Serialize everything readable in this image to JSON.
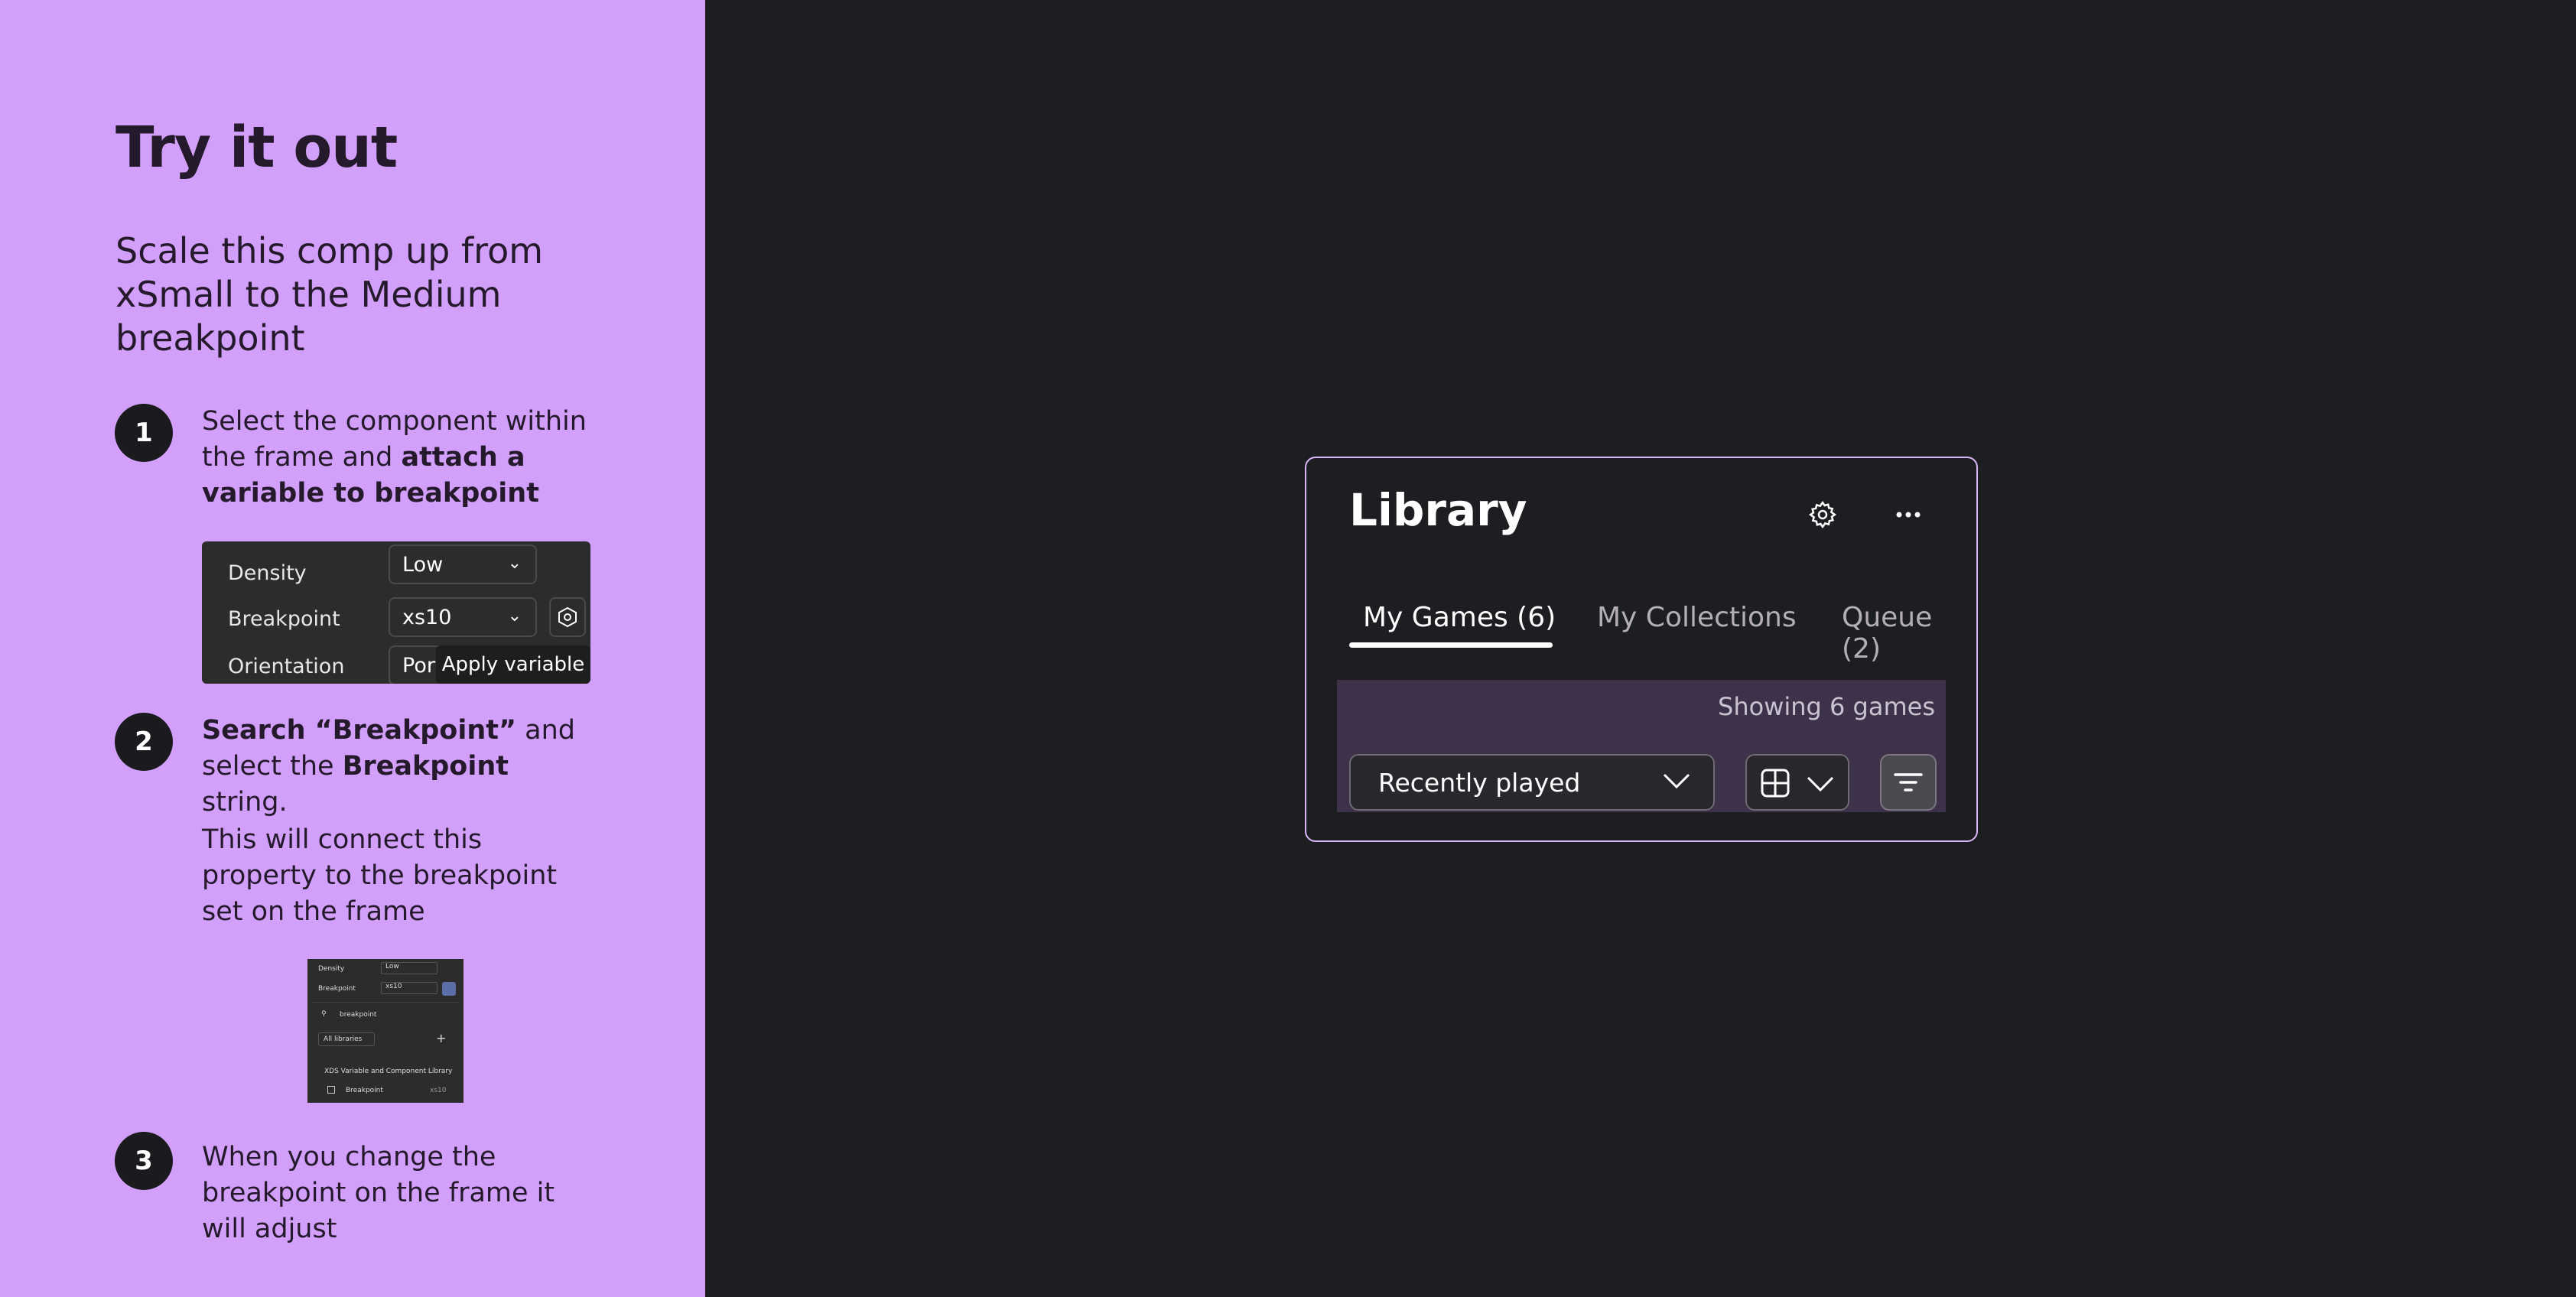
{
  "instructions": {
    "title": "Try it out",
    "subtitle": "Scale this comp up from xSmall to the Medium breakpoint",
    "step1": {
      "number": "1",
      "text_a": "Select the component within the frame and ",
      "text_b": "attach a variable to breakpoint"
    },
    "panel1": {
      "density_label": "Density",
      "density_value": "Low",
      "breakpoint_label": "Breakpoint",
      "breakpoint_value": "xs10",
      "orientation_label": "Orientation",
      "orientation_value": "Port",
      "tooltip": "Apply variable"
    },
    "step2": {
      "number": "2",
      "bold_a": "Search “Breakpoint”",
      "text_a": " and select the ",
      "bold_b": "Breakpoint",
      "text_b": " string.",
      "note": "This will connect this property to the breakpoint set on the frame"
    },
    "panel2": {
      "density_label": "Density",
      "density_value": "Low",
      "breakpoint_label": "Breakpoint",
      "breakpoint_value": "xs10",
      "search_value": "breakpoint",
      "filter_label": "All libraries",
      "library_name": "XDS Variable and Component Library",
      "result_label": "Breakpoint",
      "result_value": "xs10"
    },
    "step3": {
      "number": "3",
      "text": "When you change the breakpoint on the frame it will adjust"
    }
  },
  "library": {
    "title": "Library",
    "settings_icon": "gear-icon",
    "more_icon": "more-horizontal-icon",
    "tabs": [
      {
        "label": "My Games (6)",
        "active": true
      },
      {
        "label": "My Collections",
        "active": false
      },
      {
        "label": "Queue (2)",
        "active": false
      }
    ],
    "showing_text": "Showing 6 games",
    "sort_label": "Recently played",
    "view_icon": "grid-icon",
    "filter_icon": "filter-icon"
  },
  "colors": {
    "panel_bg": "#d29ffa",
    "canvas_bg": "#1d1e21",
    "card_border": "#d9b6f7",
    "toolbar_band": "#3e324a"
  }
}
